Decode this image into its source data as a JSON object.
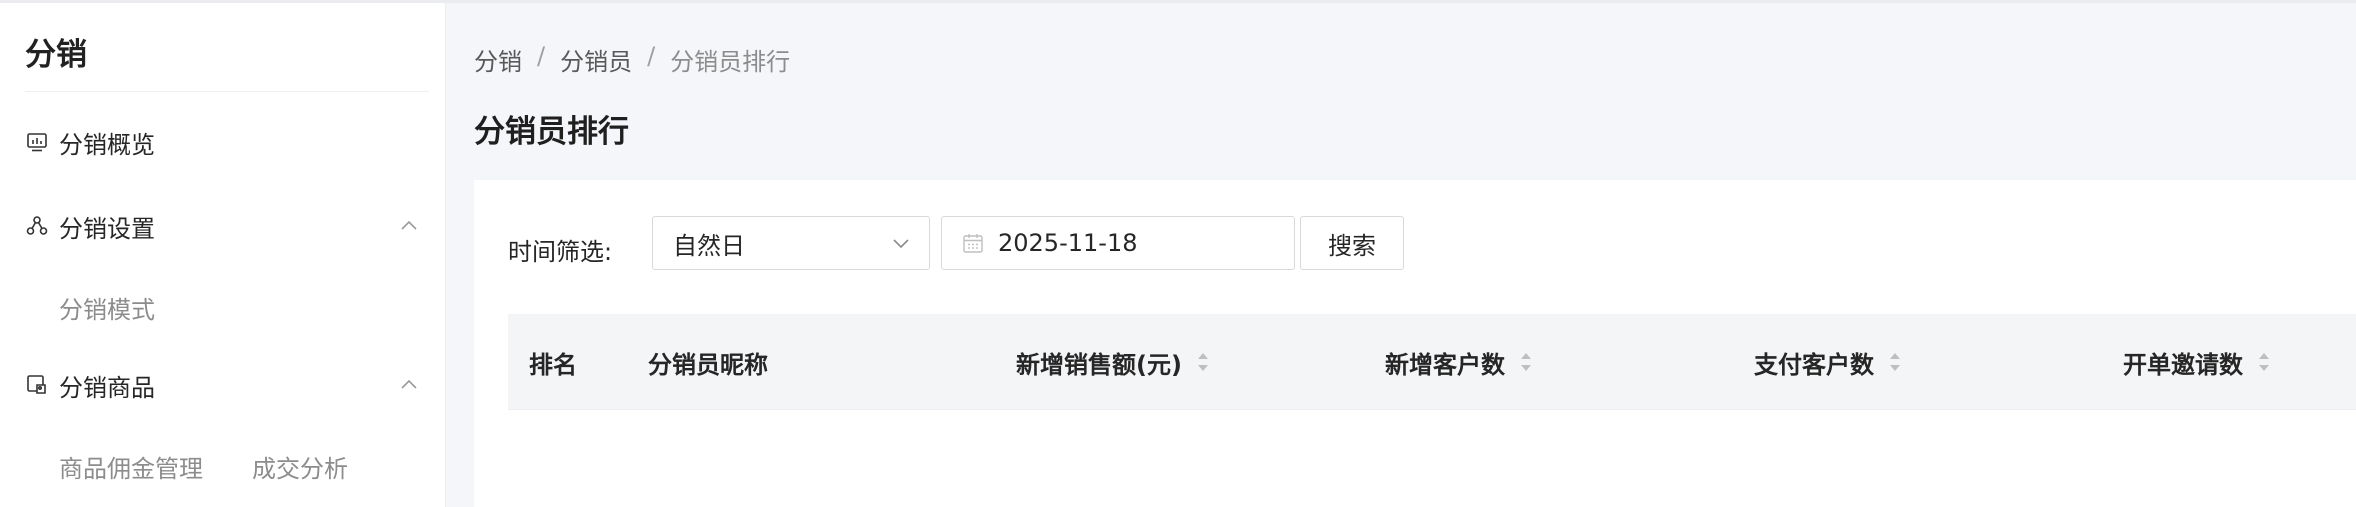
{
  "sidebar": {
    "title": "分销",
    "items": [
      {
        "label": "分销概览",
        "icon": "dashboard-icon"
      },
      {
        "label": "分销设置",
        "icon": "distribution-network-icon",
        "sub": [
          "分销模式"
        ]
      },
      {
        "label": "分销商品",
        "icon": "product-tag-icon",
        "sub": [
          "商品佣金管理",
          "成交分析"
        ]
      }
    ]
  },
  "breadcrumb": [
    "分销",
    "分销员",
    "分销员排行"
  ],
  "page": {
    "title": "分销员排行"
  },
  "filter": {
    "label": "时间筛选:",
    "period": "自然日",
    "date": "2025-11-18",
    "search_label": "搜索"
  },
  "table": {
    "columns": [
      "排名",
      "分销员昵称",
      "新增销售额(元)",
      "新增客户数",
      "支付客户数",
      "开单邀请数"
    ]
  },
  "colors": {
    "background": "#f5f6f9",
    "surface": "#ffffff",
    "header": "#f4f5f7",
    "muted": "#8c8c8c"
  }
}
